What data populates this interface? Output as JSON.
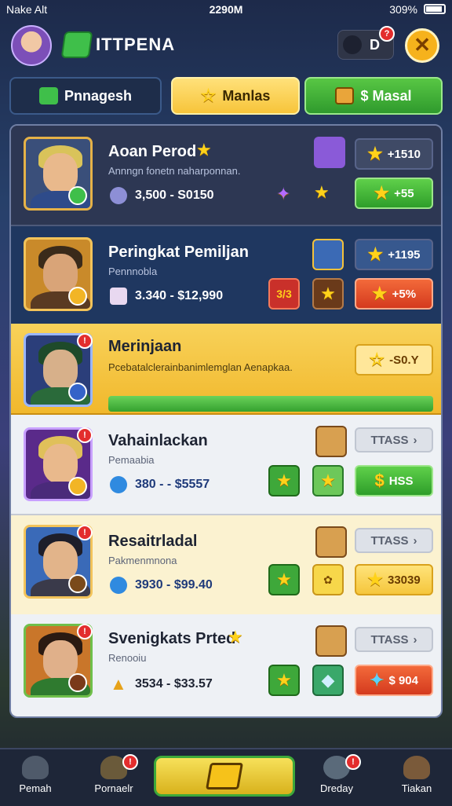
{
  "status_bar": {
    "carrier": "Nake Alt",
    "time": "2290M",
    "battery": "309%"
  },
  "header": {
    "title": "ITTPENA",
    "notification_count": "D",
    "notification_badge": "?",
    "close_symbol": "✕"
  },
  "tabs": [
    {
      "label": "Pnnagesh"
    },
    {
      "label": "Manlas"
    },
    {
      "label": "$ Masal"
    }
  ],
  "rows": [
    {
      "name": "Aoan Perod",
      "subtitle": "Annngn fonetn naharponnan.",
      "price": "3,500 - S0150",
      "offer_label": "+1510",
      "buy_label": "+55"
    },
    {
      "name": "Peringkat Pemiljan",
      "subtitle": "Pennnobla",
      "price": "3.340 - $12,990",
      "offer_label": "+1195",
      "badge_label": "3/3",
      "buy_label": "+5%"
    },
    {
      "name": "Merinjaan",
      "subtitle": "Pcebatalclerainbanimlemglan Aenapkaa.",
      "offer_label": "-S0.Y"
    },
    {
      "name": "Vahainlackan",
      "subtitle": "Pemaabia",
      "price": "380 - - $5557",
      "offer_label": "TTASS",
      "buy_label": "HSS"
    },
    {
      "name": "Resaitrladal",
      "subtitle": "Pakmenmnona",
      "price": "3930 - $99.40",
      "offer_label": "TTASS",
      "buy_label": "33039"
    },
    {
      "name": "Svenigkats Prted",
      "subtitle": "Renooiu",
      "price": "3534 - $33.57",
      "offer_label": "TTASS",
      "buy_label": "$ 904"
    }
  ],
  "nav": [
    {
      "label": "Pemah"
    },
    {
      "label": "Pornaelr"
    },
    {
      "label": "Dreday"
    },
    {
      "label": "Tiakan"
    }
  ],
  "colors": {
    "accent_yellow": "#f6b21c",
    "accent_green": "#3fbf4a",
    "accent_red": "#e32d2d"
  }
}
